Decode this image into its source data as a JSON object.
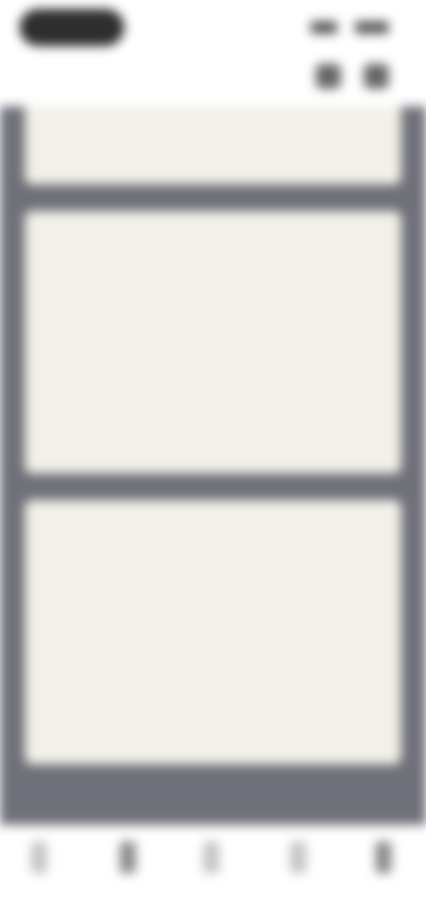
{
  "header": {
    "title": ""
  },
  "cards": [
    {
      "title": "",
      "tag": "",
      "meta": "",
      "highlight": "",
      "body": ""
    },
    {
      "title": "",
      "tag": "",
      "meta": "",
      "highlight": "",
      "body": ""
    },
    {
      "title": "",
      "tag": "",
      "meta": "",
      "highlight": "",
      "body": ""
    }
  ],
  "icons": {
    "status_pill": "status-pill-icon",
    "signal": "signal-icon",
    "battery": "battery-icon",
    "header_action_1": "action-icon",
    "header_action_2": "more-icon",
    "tabs": [
      "tab-icon-1",
      "tab-icon-2",
      "tab-icon-3",
      "tab-icon-4",
      "tab-icon-5"
    ]
  },
  "colors": {
    "feed_background": "#6f7079",
    "card_background": "#f2f0e8",
    "accent_pink": "#d44a78",
    "tabbar_background": "#ffffff"
  }
}
